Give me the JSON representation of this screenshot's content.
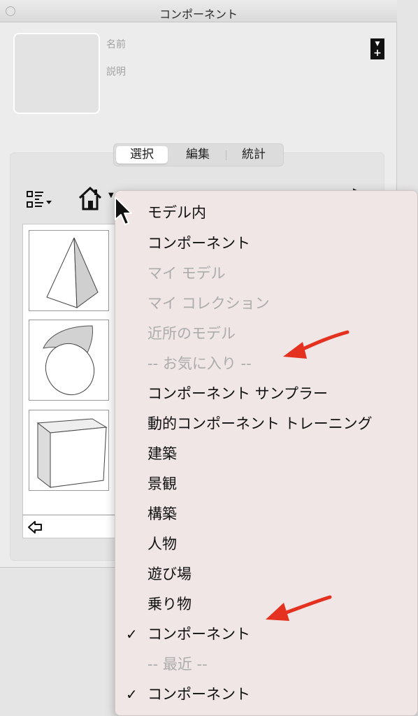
{
  "window": {
    "title": "コンポーネント"
  },
  "info": {
    "name_label": "名前",
    "description_label": "説明"
  },
  "tabs": [
    {
      "label": "選択",
      "active": true
    },
    {
      "label": "編集",
      "active": false
    },
    {
      "label": "統計",
      "active": false
    }
  ],
  "toolbar": {
    "view_icon": "list-view-icon",
    "home_icon": "home-icon"
  },
  "components": [
    {
      "name": "pyramid",
      "icon": "pyramid-thumbnail"
    },
    {
      "name": "cone",
      "icon": "cone-thumbnail"
    },
    {
      "name": "cube",
      "icon": "cube-thumbnail"
    }
  ],
  "menu": {
    "items": [
      {
        "label": "モデル内",
        "enabled": true,
        "checked": false
      },
      {
        "label": "コンポーネント",
        "enabled": true,
        "checked": false
      },
      {
        "label": "マイ モデル",
        "enabled": false,
        "checked": false
      },
      {
        "label": "マイ コレクション",
        "enabled": false,
        "checked": false
      },
      {
        "label": "近所のモデル",
        "enabled": false,
        "checked": false
      },
      {
        "label": "-- お気に入り --",
        "enabled": false,
        "checked": false
      },
      {
        "label": "コンポーネント サンプラー",
        "enabled": true,
        "checked": false
      },
      {
        "label": "動的コンポーネント トレーニング",
        "enabled": true,
        "checked": false
      },
      {
        "label": "建築",
        "enabled": true,
        "checked": false
      },
      {
        "label": "景観",
        "enabled": true,
        "checked": false
      },
      {
        "label": "構築",
        "enabled": true,
        "checked": false
      },
      {
        "label": "人物",
        "enabled": true,
        "checked": false
      },
      {
        "label": "遊び場",
        "enabled": true,
        "checked": false
      },
      {
        "label": "乗り物",
        "enabled": true,
        "checked": false
      },
      {
        "label": "コンポーネント",
        "enabled": true,
        "checked": true
      },
      {
        "label": "-- 最近 --",
        "enabled": false,
        "checked": false
      },
      {
        "label": "コンポーネント",
        "enabled": true,
        "checked": true
      }
    ],
    "check_glyph": "✓"
  },
  "colors": {
    "annotation_arrow": "#e5311f",
    "menu_background": "#f0e6e6",
    "disabled_text": "#acacac"
  }
}
